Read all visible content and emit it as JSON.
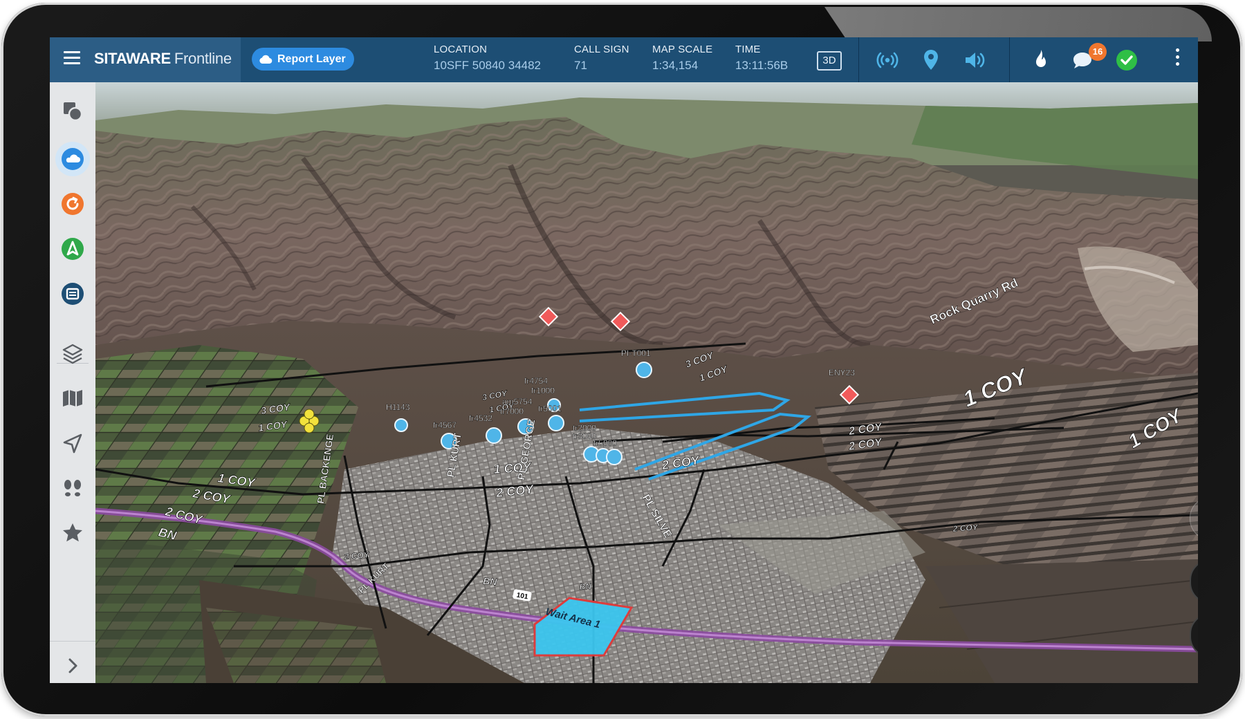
{
  "app": {
    "brand_bold": "SITAWARE",
    "brand_light": "Frontline",
    "report_layer_label": "Report Layer"
  },
  "status": {
    "location_label": "LOCATION",
    "location_value": "10SFF 50840 34482",
    "callsign_label": "CALL SIGN",
    "callsign_value": "71",
    "scale_label": "MAP SCALE",
    "scale_value": "1:34,154",
    "time_label": "TIME",
    "time_value": "13:11:56B",
    "view_mode_label": "3D"
  },
  "toolbar_icons": [
    "radio-signal-icon",
    "location-pin-icon",
    "speaker-icon",
    "fire-icon",
    "chat-icon",
    "check-status-icon",
    "more-vertical-icon"
  ],
  "notifications": {
    "chat_count": "16"
  },
  "colors": {
    "topbar": "#1d4e74",
    "brand_block": "#2c5d85",
    "accent": "#2d8be0",
    "badge": "#f0762e",
    "ok": "#2fbf46",
    "hostile": "#f05a5a",
    "friendly": "#4fb5e8",
    "area": "#3cc6ef"
  },
  "sidebar": {
    "items": [
      "layers-select-icon",
      "cloud-report-icon",
      "refresh-orders-icon",
      "navigate-icon",
      "tasks-icon",
      "layers-icon",
      "map-book-icon",
      "send-location-icon",
      "footsteps-icon",
      "favorites-icon"
    ],
    "expand_icon": "chevron-right-icon"
  },
  "map": {
    "unit_labels": [
      "3 COY",
      "1 COY",
      "1 COY",
      "2 COY",
      "2 COY",
      "1 COY",
      "2 COY",
      "2 COY",
      "BN",
      "BN",
      "1 COY",
      "2 COY",
      "2 COY",
      "3 COY",
      "1 COY",
      "3 COY",
      "1 COY",
      "2 COY",
      "BN",
      "1 COY",
      "2 COY"
    ],
    "road_labels": [
      "PL BACKENGE",
      "PL KURT",
      "PL GEORGE",
      "PL SILVE",
      "PL KURT",
      "Rock Quarry Rd"
    ],
    "unit_ids": [
      "H1143",
      "fr4567",
      "fr4532",
      "tr7000",
      "am5754",
      "fr4754",
      "fr1000",
      "tr5001",
      "tr2000",
      "tr3000",
      "fr5000",
      "PI-T001",
      "ENY23"
    ],
    "area_label": "Wait Area 1",
    "route_marker": "101"
  }
}
